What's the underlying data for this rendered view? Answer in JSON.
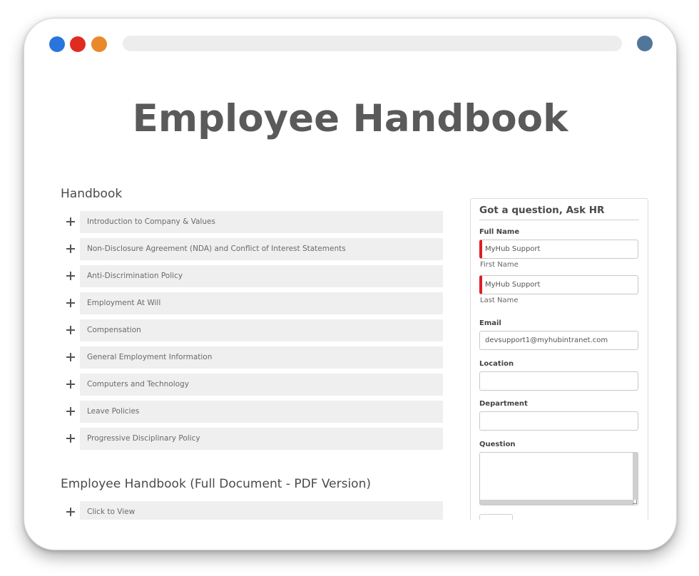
{
  "page": {
    "title": "Employee Handbook"
  },
  "handbook": {
    "heading": "Handbook",
    "items": [
      {
        "label": "Introduction to Company & Values"
      },
      {
        "label": "Non-Disclosure Agreement (NDA) and Conflict of Interest Statements"
      },
      {
        "label": "Anti-Discrimination Policy"
      },
      {
        "label": "Employment At Will"
      },
      {
        "label": "Compensation"
      },
      {
        "label": "General Employment Information"
      },
      {
        "label": "Computers and Technology"
      },
      {
        "label": "Leave Policies"
      },
      {
        "label": "Progressive Disciplinary Policy"
      }
    ]
  },
  "pdf_section": {
    "heading": "Employee Handbook (Full Document - PDF Version)",
    "items": [
      {
        "label": "Click to View"
      }
    ]
  },
  "hr_form": {
    "title": "Got a question, Ask HR",
    "full_name_label": "Full Name",
    "first_name_value": "MyHub Support",
    "first_name_sublabel": "First Name",
    "last_name_value": "MyHub Support",
    "last_name_sublabel": "Last Name",
    "email_label": "Email",
    "email_value": "devsupport1@myhubintranet.com",
    "location_label": "Location",
    "location_value": "",
    "department_label": "Department",
    "department_value": "",
    "question_label": "Question",
    "question_value": ""
  },
  "window": {
    "dot_colors": [
      "#2a74de",
      "#e02b20",
      "#e9892c"
    ],
    "profile_color": "#52759a"
  }
}
